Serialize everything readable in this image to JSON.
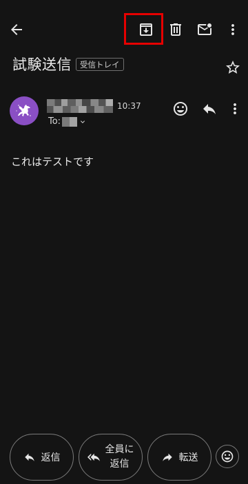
{
  "toolbar": {
    "back_icon": "arrow-back-icon",
    "archive_icon": "archive-icon",
    "delete_icon": "trash-icon",
    "mark_unread_icon": "mail-unread-icon",
    "more_icon": "more-vert-icon",
    "highlight_color": "#e60000"
  },
  "message": {
    "subject": "試験送信",
    "label": "受信トレイ",
    "time": "10:37",
    "to_label": "To:",
    "body": "これはテストです",
    "avatar_color": "#8a4fc4"
  },
  "actions": {
    "reply": "返信",
    "reply_all_line1": "全員に",
    "reply_all_line2": "返信",
    "forward": "転送"
  }
}
